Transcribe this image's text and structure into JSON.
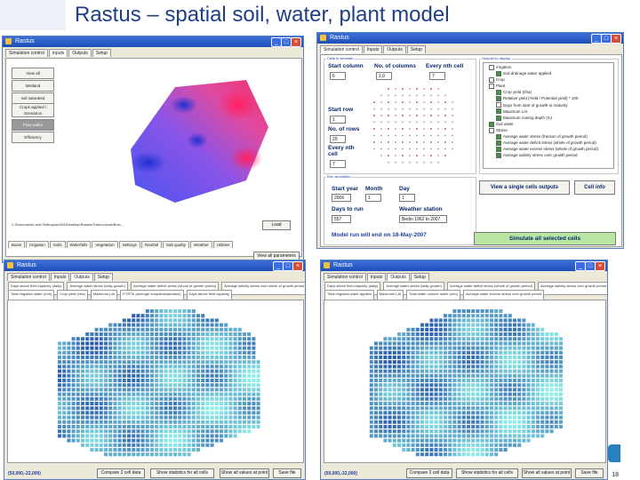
{
  "slide": {
    "title": "Rastus – spatial soil, water, plant model",
    "page_number": "18"
  },
  "colors": {
    "titlebar": "#1d4fb8",
    "slide_title": "#1f3e86",
    "label_blue": "#0a2a6a",
    "grid_dark": "#1f4fa8",
    "grid_light": "#8ef0e8",
    "simulate_green": "#b9e7a3"
  },
  "win_tl": {
    "title": "Rastus",
    "tabs": [
      "Simulation control",
      "Inputs",
      "Outputs",
      "Setup"
    ],
    "side_buttons": [
      "View all",
      "Wetland",
      "soil saturated",
      "Crops applied / Scenarios",
      "Flow paths",
      "Efficiency"
    ],
    "path_text": "C:\\Documents and Settings\\wr184\\Desktop\\Rastus\\Tuberculosis\\Bus\\...",
    "load_button": "Load",
    "bottom_tabs": [
      "Basin",
      "Irrigation",
      "Soils",
      "Waterfalls",
      "Vegetation",
      "Settings",
      "Rainfall",
      "Salt quality",
      "Weather",
      "Utilities"
    ],
    "show_button": "View all parameters"
  },
  "win_tr": {
    "title": "Rastus",
    "tabs": [
      "Simulation control",
      "Inputs",
      "Outputs",
      "Setup"
    ],
    "cells_to_simulate": "Cells to simulate",
    "start_column_label": "Start column",
    "start_column_value": "6",
    "num_columns_label": "No. of columns",
    "num_columns_value": "1.0",
    "every_nth_cell_label": "Every nth cell",
    "every_nth_cell_value": "7",
    "start_row_label": "Start row",
    "start_row_value": "1",
    "num_rows_label": "No. of rows",
    "num_rows_value": "20",
    "every_nth_cell2_label": "Every nth cell",
    "every_nth_cell2_value": "7",
    "output_display": "Outputs to display",
    "tree_items": [
      {
        "label": "Irrigation",
        "checked": false
      },
      {
        "label": "Soil drainage water applied",
        "checked": true
      },
      {
        "label": "Crop",
        "checked": false
      },
      {
        "label": "Plant",
        "checked": false
      },
      {
        "label": "Crop yield (t/ha)",
        "checked": true
      },
      {
        "label": "Relative yield (Yield / Potential yield) * 100",
        "checked": true
      },
      {
        "label": "Days from start of growth to maturity",
        "checked": false
      },
      {
        "label": "Maximum LAI",
        "checked": true
      },
      {
        "label": "Maximum rooting depth (m)",
        "checked": true
      },
      {
        "label": "Soil water",
        "checked": true
      },
      {
        "label": "Stress",
        "checked": false
      },
      {
        "label": "Average water stress (fraction of growth period)",
        "checked": true
      },
      {
        "label": "Average water deficit stress (whole of growth period)",
        "checked": true
      },
      {
        "label": "Average water excess stress (whole of growth period)",
        "checked": true
      },
      {
        "label": "Average salinity stress over growth period",
        "checked": true
      }
    ],
    "run_simulation": "Run simulation",
    "start_year_label": "Start year",
    "start_year_value": "2006",
    "month_label": "Month",
    "month_value": "1",
    "day_label": "Day",
    "day_value": "1",
    "days_to_run_label": "Days to run",
    "days_to_run_value": "557",
    "weather_station_label": "Weather station",
    "weather_station_value": "Bedin 1962 to 2007",
    "model_end_text": "Model run will end on 18-May-2007",
    "view_single_button": "View a single cells outputs",
    "cell_info_button": "Cell info",
    "simulate_all_button": "Simulate all selected cells"
  },
  "win_bl": {
    "title": "Rastus",
    "tabs": [
      "Simulation control",
      "Inputs",
      "Outputs",
      "Setup"
    ],
    "header_cells": [
      "Days above field capacity (daily)",
      "Average water stress (daily growth)",
      "Average water deficit stress (whole of growth period)",
      "Average salinity stress over whole of growth period"
    ],
    "header_cells2": [
      "Total irrigation water (mm)",
      "Crop yield (t/ha)",
      "Maximum LAI",
      "ET/ETo (average evapotranspiration)",
      "Days above field capacity"
    ],
    "coord_text": "(50,000,-22,000)",
    "buttons": [
      "Compare 2 cell data",
      "Show statistics for all cells",
      "Show all values at point",
      "Save file"
    ]
  },
  "win_br": {
    "title": "Rastus",
    "tabs": [
      "Simulation control",
      "Inputs",
      "Outputs",
      "Setup"
    ],
    "header_cells": [
      "Days above field capacity (daily)",
      "Average water stress (daily growth)",
      "Average water deficit stress (whole of growth period)",
      "Average salinity stress over growth period"
    ],
    "header_cells2": [
      "Total irrigation water applied",
      "Maximum LAI",
      "Total water volume outlet (mm)",
      "Average water excess stress over growth period"
    ],
    "coord_text": "(50,000,-22,000)",
    "buttons": [
      "Compare 2 cell data",
      "Show statistics for all cells",
      "Show all values at point",
      "Save file"
    ]
  }
}
